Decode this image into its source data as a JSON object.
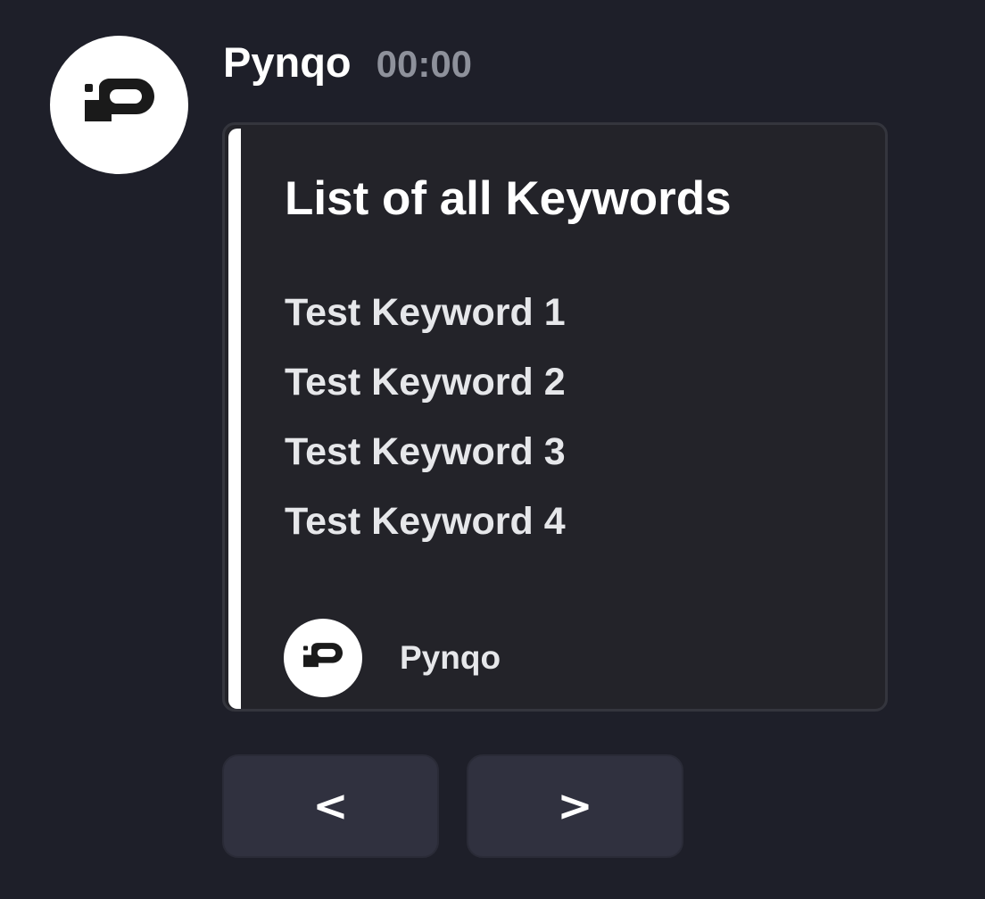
{
  "message": {
    "author": "Pynqo",
    "timestamp": "00:00",
    "avatar_icon": "pynqo-logo-icon"
  },
  "embed": {
    "accent_color": "#ffffff",
    "title": "List of all Keywords",
    "keywords": [
      "Test Keyword 1",
      "Test Keyword 2",
      "Test Keyword 3",
      "Test Keyword 4"
    ],
    "footer": {
      "icon": "pynqo-logo-icon",
      "text": "Pynqo"
    }
  },
  "buttons": {
    "prev_label": "<",
    "next_label": ">"
  },
  "colors": {
    "background": "#1e1f29",
    "embed_background": "#232329",
    "button_background": "#30313f",
    "timestamp": "#8e919b"
  }
}
